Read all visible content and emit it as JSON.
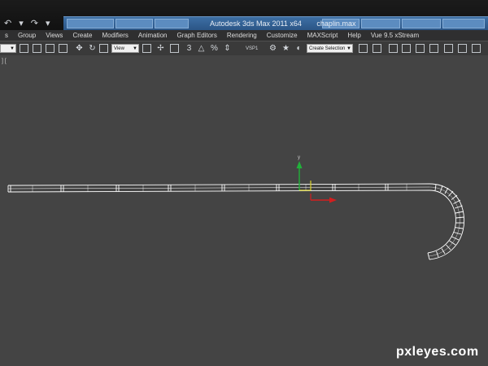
{
  "titlebar": {
    "app_title": "Autodesk 3ds Max  2011 x64",
    "file_name": "chaplin.max",
    "quick_access": {
      "undo": "↶",
      "undo_menu": "▾",
      "redo": "↷",
      "redo_menu": "▾"
    }
  },
  "menubar": {
    "items": [
      "s",
      "Group",
      "Views",
      "Create",
      "Modifiers",
      "Animation",
      "Graph Editors",
      "Rendering",
      "Customize",
      "MAXScript",
      "Help",
      "Vue 9.5 xStream"
    ]
  },
  "toolbar": {
    "view_dropdown": "View",
    "vsp_label": "VSP1",
    "selection_set": "Create Selection"
  },
  "viewport": {
    "label": "] [",
    "gizmo_y_label": "y"
  },
  "watermark": "pxleyes.com",
  "colors": {
    "title_bg": "#111111",
    "taskbar_blue": "#2b5586",
    "menubar_bg": "#2f2f30",
    "toolbar_bg": "#3a3a3a",
    "viewport_bg": "#444444",
    "wireframe": "#ffffff",
    "gizmo_y": "#21b23a",
    "gizmo_x": "#d11f1f"
  }
}
